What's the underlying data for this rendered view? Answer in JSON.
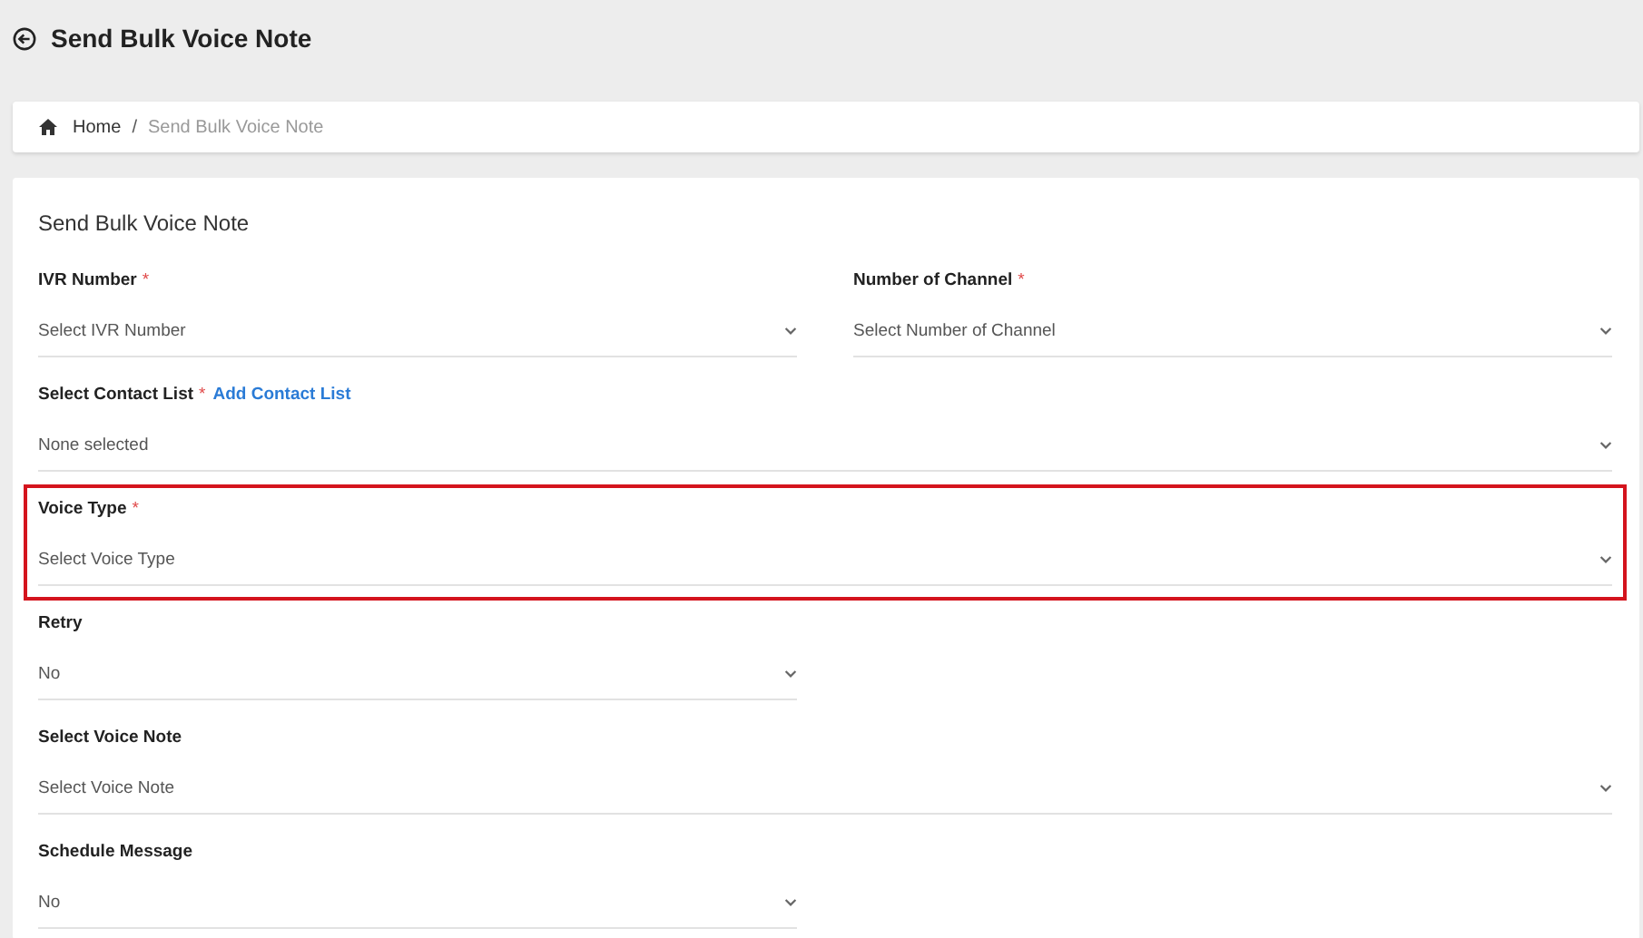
{
  "header": {
    "title": "Send Bulk Voice Note"
  },
  "breadcrumb": [
    {
      "label": "Home",
      "kind": "home"
    },
    {
      "label": "/",
      "kind": "separator"
    },
    {
      "label": "Send Bulk Voice Note",
      "kind": "current"
    }
  ],
  "form": {
    "title": "Send Bulk Voice Note",
    "fields": [
      {
        "label": "IVR Number",
        "required_mark": "*",
        "placeholder": "Select IVR Number",
        "kind": "half",
        "highlighted": false
      },
      {
        "label": "Number of Channel",
        "required_mark": "*",
        "placeholder": "Select Number of Channel",
        "kind": "half",
        "highlighted": false
      },
      {
        "label": "Select Contact List",
        "required_mark": "*",
        "link": "Add Contact List",
        "value": "None selected",
        "kind": "full",
        "highlighted": false
      },
      {
        "label": "Voice Type",
        "required_mark": "*",
        "placeholder": "Select Voice Type",
        "kind": "full",
        "highlighted": true
      },
      {
        "label": "Retry",
        "value": "No",
        "kind": "half",
        "highlighted": false
      },
      {
        "label": "Select Voice Note",
        "placeholder": "Select Voice Note",
        "kind": "full",
        "highlighted": false
      },
      {
        "label": "Schedule Message",
        "value": "No",
        "kind": "half",
        "highlighted": false
      }
    ]
  }
}
